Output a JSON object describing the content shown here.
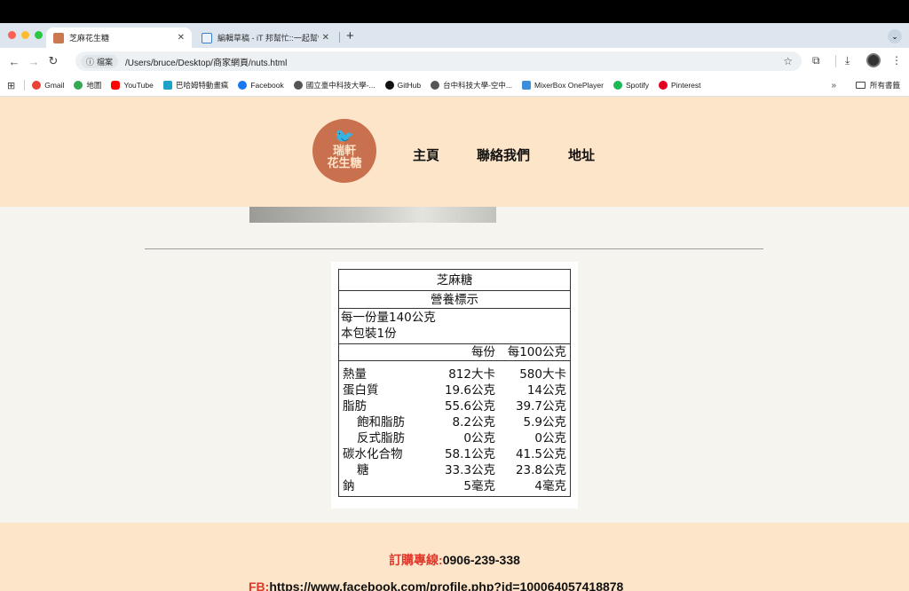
{
  "browser": {
    "tabs": [
      {
        "title": "芝麻花生糖",
        "active": true
      },
      {
        "title": "編輯草稿 - iT 邦幫忙::一起幫忙",
        "active": false
      }
    ],
    "address": {
      "info_label": "檔案",
      "url": "/Users/bruce/Desktop/商家網頁/nuts.html"
    },
    "bookmarks": [
      {
        "label": "Gmail",
        "color": "#ea4335"
      },
      {
        "label": "地圖",
        "color": "#34a853"
      },
      {
        "label": "YouTube",
        "color": "#ff0000"
      },
      {
        "label": "巴哈姆特動畫瘋",
        "color": "#1da1c8"
      },
      {
        "label": "Facebook",
        "color": "#1877f2"
      },
      {
        "label": "國立臺中科技大學-...",
        "color": "#555555"
      },
      {
        "label": "GitHub",
        "color": "#111111"
      },
      {
        "label": "台中科技大學-空中...",
        "color": "#555555"
      },
      {
        "label": "MixerBox OnePlayer",
        "color": "#3b8ed8"
      },
      {
        "label": "Spotify",
        "color": "#1db954"
      },
      {
        "label": "Pinterest",
        "color": "#e60023"
      }
    ],
    "bookmarks_more": "»",
    "bookmarks_folder": "所有書籤"
  },
  "site": {
    "logo_text": "瑞軒\n花生糖",
    "nav": {
      "home": "主頁",
      "contact": "聯絡我們",
      "address": "地址"
    },
    "nutrition": {
      "product": "芝麻糖",
      "heading": "營養標示",
      "serving_size": "每一份量140公克",
      "servings": "本包裝1份",
      "col_per_serving": "每份",
      "col_per_100g": "每100公克",
      "rows": [
        {
          "name": "熱量",
          "per_serving": "812大卡",
          "per_100g": "580大卡",
          "indent": false
        },
        {
          "name": "蛋白質",
          "per_serving": "19.6公克",
          "per_100g": "14公克",
          "indent": false
        },
        {
          "name": "脂肪",
          "per_serving": "55.6公克",
          "per_100g": "39.7公克",
          "indent": false
        },
        {
          "name": "飽和脂肪",
          "per_serving": "8.2公克",
          "per_100g": "5.9公克",
          "indent": true
        },
        {
          "name": "反式脂肪",
          "per_serving": "0公克",
          "per_100g": "0公克",
          "indent": true
        },
        {
          "name": "碳水化合物",
          "per_serving": "58.1公克",
          "per_100g": "41.5公克",
          "indent": false
        },
        {
          "name": "糖",
          "per_serving": "33.3公克",
          "per_100g": "23.8公克",
          "indent": true
        },
        {
          "name": "鈉",
          "per_serving": "5毫克",
          "per_100g": "4毫克",
          "indent": false
        }
      ]
    },
    "footer": {
      "order_label": "訂購專線:",
      "order_phone": "0906-239-338",
      "fb_label": "FB:",
      "fb_url": "https://www.facebook.com/profile.php?id=100064057418878"
    }
  }
}
